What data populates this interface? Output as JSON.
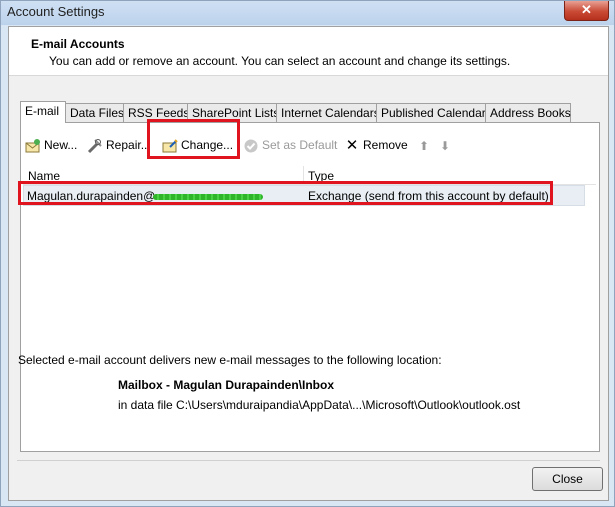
{
  "window": {
    "title": "Account Settings",
    "close_glyph": "✕"
  },
  "header": {
    "title": "E-mail Accounts",
    "description": "You can add or remove an account. You can select an account and change its settings."
  },
  "tabs": [
    {
      "label": "E-mail",
      "active": true
    },
    {
      "label": "Data Files"
    },
    {
      "label": "RSS Feeds"
    },
    {
      "label": "SharePoint Lists"
    },
    {
      "label": "Internet Calendars"
    },
    {
      "label": "Published Calendars"
    },
    {
      "label": "Address Books"
    }
  ],
  "toolbar": {
    "new_label": "New...",
    "repair_label": "Repair...",
    "change_label": "Change...",
    "set_default_label": "Set as Default",
    "remove_label": "Remove",
    "remove_glyph": "✕",
    "move_up_glyph": "⬆",
    "move_down_glyph": "⬇"
  },
  "accounts_list": {
    "columns": [
      "Name",
      "Type"
    ],
    "rows": [
      {
        "name": "Magulan.durapainden@",
        "type": "Exchange (send from this account by default)"
      }
    ]
  },
  "delivery": {
    "intro": "Selected e-mail account delivers new e-mail messages to the following location:",
    "mailbox": "Mailbox - Magulan Durapainden\\Inbox",
    "data_file": "in data file C:\\Users\\mduraipandia\\AppData\\...\\Microsoft\\Outlook\\outlook.ost"
  },
  "footer": {
    "close_label": "Close"
  },
  "colors": {
    "annotation_red": "#e0141e",
    "redaction_green": "#2fb42a"
  },
  "icons": {
    "new": "new-account-icon",
    "repair": "repair-icon",
    "change": "change-icon",
    "set_default": "set-default-icon",
    "remove": "remove-icon",
    "up": "move-up-icon",
    "down": "move-down-icon"
  }
}
